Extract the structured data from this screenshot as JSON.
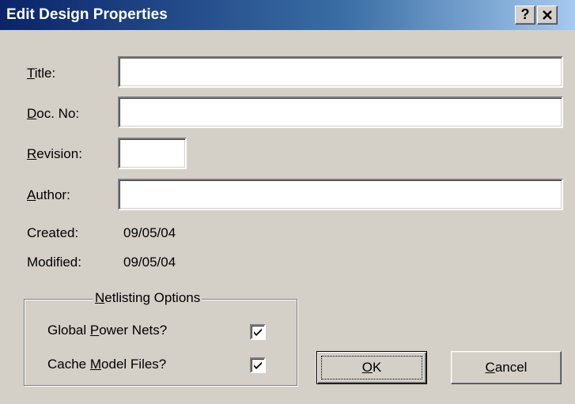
{
  "window": {
    "title": "Edit Design Properties",
    "help_label": "?",
    "close_icon": "close-icon"
  },
  "fields": {
    "title": {
      "label_mnemonic": "T",
      "label_rest": "itle:",
      "value": ""
    },
    "doc_no": {
      "label_mnemonic": "D",
      "label_rest": "oc. No:",
      "value": ""
    },
    "revision": {
      "label_mnemonic": "R",
      "label_rest": "evision:",
      "value": ""
    },
    "author": {
      "label_mnemonic": "A",
      "label_rest": "uthor:",
      "value": ""
    }
  },
  "info": {
    "created_label": "Created:",
    "created_value": "09/05/04",
    "modified_label": "Modified:",
    "modified_value": "09/05/04"
  },
  "netlisting": {
    "group_mnemonic": "N",
    "group_rest": "etlisting Options",
    "global_power": {
      "label_before": "Global ",
      "label_mnemonic": "P",
      "label_after": "ower Nets?",
      "checked": true
    },
    "cache_model": {
      "label_before": "Cache ",
      "label_mnemonic": "M",
      "label_after": "odel Files?",
      "checked": true
    }
  },
  "buttons": {
    "ok": {
      "mnemonic": "O",
      "rest": "K"
    },
    "cancel": {
      "mnemonic": "C",
      "rest": "ancel"
    }
  }
}
